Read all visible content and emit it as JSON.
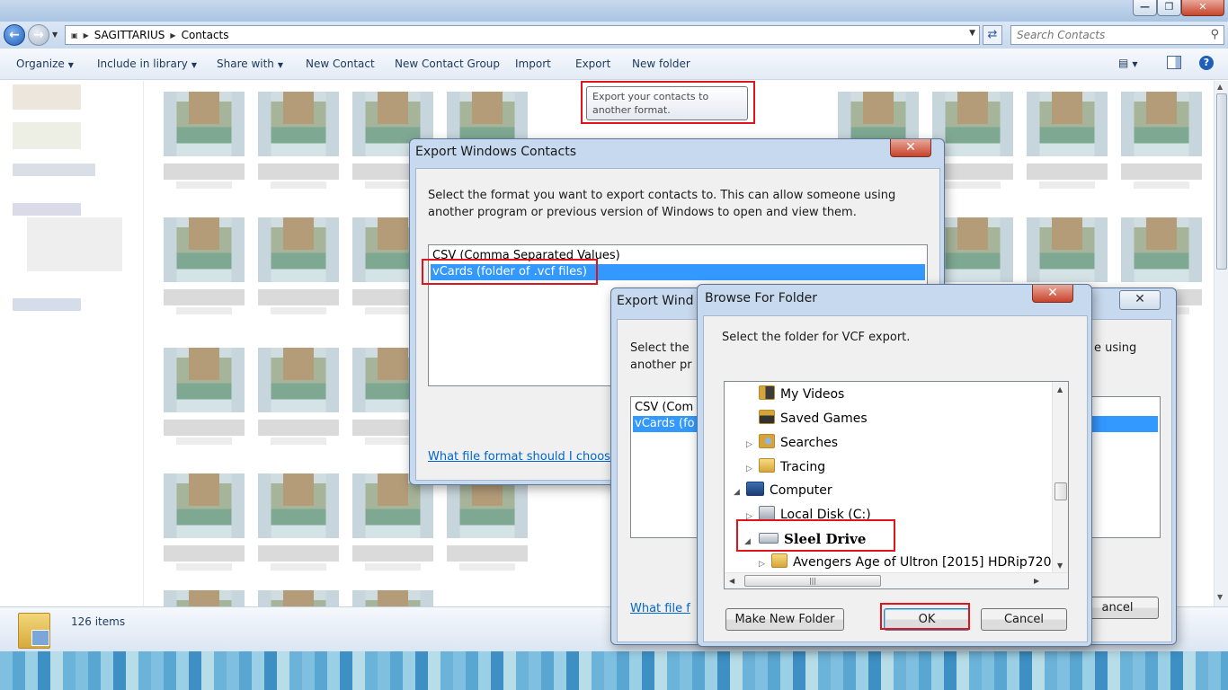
{
  "window": {
    "controls": {
      "minimize": "—",
      "maximize": "❐",
      "close": "✕"
    }
  },
  "address": {
    "path": [
      "SAGITTARIUS",
      "Contacts"
    ],
    "search_placeholder": "Search Contacts"
  },
  "toolbar": {
    "organize": "Organize",
    "include_in_library": "Include in library",
    "share_with": "Share with",
    "new_contact": "New Contact",
    "new_contact_group": "New Contact Group",
    "import": "Import",
    "export": "Export",
    "new_folder": "New folder"
  },
  "tooltip": {
    "text": "Export your contacts to another format."
  },
  "status": {
    "count": "126 items"
  },
  "export_dialog": {
    "title": "Export Windows Contacts",
    "instructions": "Select the format you want to export contacts to.  This can allow someone using another program or previous version of Windows to open and view them.",
    "formats": [
      "CSV (Comma Separated Values)",
      "vCards (folder of .vcf files)"
    ],
    "selected_index": 1,
    "help_link": "What file format should I choos"
  },
  "export_dialog_back": {
    "title": "Export Wind",
    "instructions_line1": "Select the",
    "instructions_line2": "another pr",
    "instructions_right": "e using",
    "formats": [
      "CSV (Com",
      "vCards (fo"
    ],
    "help_link": "What file f",
    "cancel_partial": "ancel"
  },
  "browse_dialog": {
    "title": "Browse For Folder",
    "instructions": "Select the folder for VCF export.",
    "tree": [
      {
        "label": "My Videos",
        "icon": "video-folder-icon",
        "level": 1
      },
      {
        "label": "Saved Games",
        "icon": "games-folder-icon",
        "level": 1
      },
      {
        "label": "Searches",
        "icon": "search-folder-icon",
        "level": 1
      },
      {
        "label": "Tracing",
        "icon": "folder-icon",
        "level": 1
      },
      {
        "label": "Computer",
        "icon": "computer-icon",
        "level": 0
      },
      {
        "label": "Local Disk (C:)",
        "icon": "disk-icon",
        "level": 1
      },
      {
        "label": "Sleel Drive",
        "icon": "usb-drive-icon",
        "level": 1
      },
      {
        "label": "Avengers Age of Ultron [2015] HDRip720",
        "icon": "folder-icon",
        "level": 2
      }
    ],
    "make_new_folder": "Make New Folder",
    "ok": "OK",
    "cancel": "Cancel"
  },
  "colors": {
    "selection": "#3399ff",
    "annotation": "#e1141b",
    "link": "#0066cc"
  }
}
